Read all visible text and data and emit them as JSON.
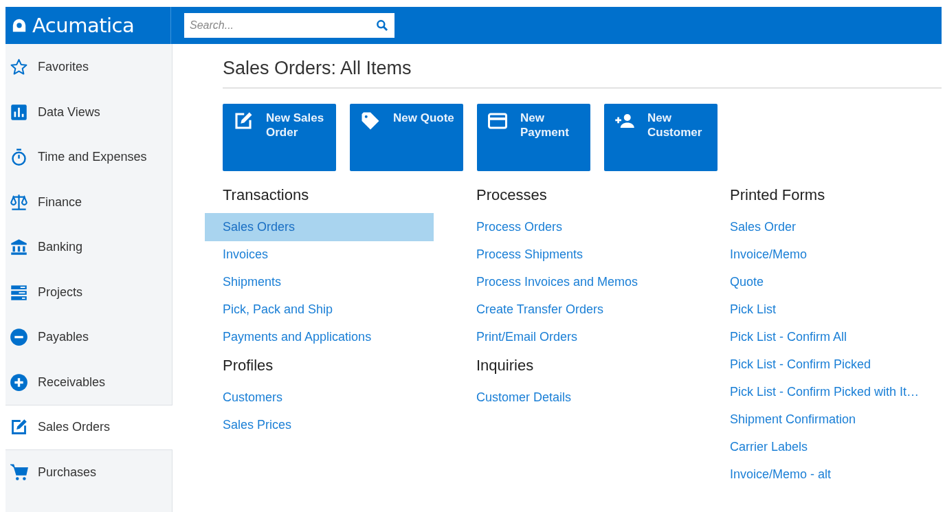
{
  "header": {
    "logo": "Acumatica",
    "search": {
      "placeholder": "Search..."
    }
  },
  "sidebar": {
    "items": [
      {
        "label": "Favorites",
        "selected": false
      },
      {
        "label": "Data Views",
        "selected": false
      },
      {
        "label": "Time and Expenses",
        "selected": false
      },
      {
        "label": "Finance",
        "selected": false
      },
      {
        "label": "Banking",
        "selected": false
      },
      {
        "label": "Projects",
        "selected": false
      },
      {
        "label": "Payables",
        "selected": false
      },
      {
        "label": "Receivables",
        "selected": false
      },
      {
        "label": "Sales Orders",
        "selected": true
      },
      {
        "label": "Purchases",
        "selected": false
      }
    ]
  },
  "page_title": "Sales Orders: All Items",
  "tiles": [
    {
      "label": "New Sales Order"
    },
    {
      "label": "New Quote"
    },
    {
      "label": "New Payment"
    },
    {
      "label": "New Customer"
    }
  ],
  "columns": [
    {
      "sections": [
        {
          "title": "Transactions",
          "links": [
            {
              "label": "Sales Orders",
              "selected": true
            },
            {
              "label": "Invoices",
              "selected": false
            },
            {
              "label": "Shipments",
              "selected": false
            },
            {
              "label": "Pick, Pack and Ship",
              "selected": false
            },
            {
              "label": "Payments and Applications",
              "selected": false
            }
          ]
        },
        {
          "title": "Profiles",
          "links": [
            {
              "label": "Customers",
              "selected": false
            },
            {
              "label": "Sales Prices",
              "selected": false
            }
          ]
        }
      ]
    },
    {
      "sections": [
        {
          "title": "Processes",
          "links": [
            {
              "label": "Process Orders",
              "selected": false
            },
            {
              "label": "Process Shipments",
              "selected": false
            },
            {
              "label": "Process Invoices and Memos",
              "selected": false
            },
            {
              "label": "Create Transfer Orders",
              "selected": false
            },
            {
              "label": "Print/Email Orders",
              "selected": false
            }
          ]
        },
        {
          "title": "Inquiries",
          "links": [
            {
              "label": "Customer Details",
              "selected": false
            }
          ]
        }
      ]
    },
    {
      "sections": [
        {
          "title": "Printed Forms",
          "links": [
            {
              "label": "Sales Order",
              "selected": false
            },
            {
              "label": "Invoice/Memo",
              "selected": false
            },
            {
              "label": "Quote",
              "selected": false
            },
            {
              "label": "Pick List",
              "selected": false
            },
            {
              "label": "Pick List - Confirm All",
              "selected": false
            },
            {
              "label": "Pick List - Confirm Picked",
              "selected": false
            },
            {
              "label": "Pick List - Confirm Picked with It…",
              "selected": false
            },
            {
              "label": "Shipment Confirmation",
              "selected": false
            },
            {
              "label": "Carrier Labels",
              "selected": false
            },
            {
              "label": "Invoice/Memo - alt",
              "selected": false
            }
          ]
        }
      ]
    }
  ]
}
